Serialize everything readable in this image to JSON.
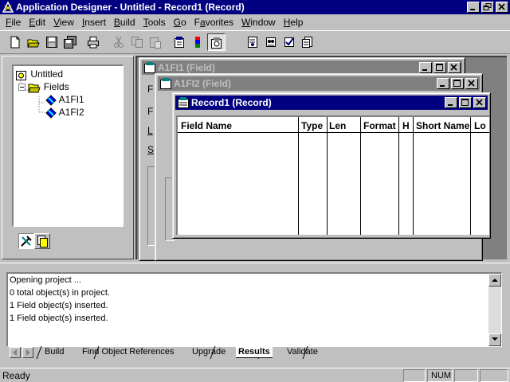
{
  "app": {
    "title": "Application Designer - Untitled - Record1 (Record)",
    "icon": "app-designer-icon"
  },
  "menu": [
    {
      "mnemonic": "F",
      "rest": "ile"
    },
    {
      "mnemonic": "E",
      "rest": "dit"
    },
    {
      "mnemonic": "V",
      "rest": "iew"
    },
    {
      "mnemonic": "I",
      "rest": "nsert"
    },
    {
      "mnemonic": "B",
      "rest": "uild"
    },
    {
      "mnemonic": "T",
      "rest": "ools"
    },
    {
      "mnemonic": "G",
      "rest": "o"
    },
    {
      "pre": "F",
      "mnemonic": "a",
      "rest": "vorites"
    },
    {
      "mnemonic": "W",
      "rest": "indow"
    },
    {
      "mnemonic": "H",
      "rest": "elp"
    }
  ],
  "toolbar": {
    "icons": [
      "new-icon",
      "open-icon",
      "save-icon",
      "save-all-icon",
      "print-icon",
      "cut-icon",
      "copy-icon",
      "paste-icon",
      "properties-icon",
      "build-icon",
      "project-workspace-icon",
      "find-references-icon",
      "record-view-icon",
      "validate-icon",
      "definition-icon"
    ]
  },
  "project_tree": {
    "root": "Untitled",
    "folder": "Fields",
    "items": [
      "A1FI1",
      "A1FI2"
    ]
  },
  "windows": {
    "field1": {
      "title": "A1FI1 (Field)"
    },
    "field2": {
      "title": "A1FI2 (Field)"
    },
    "record": {
      "title": "Record1 (Record)",
      "columns": [
        "Field Name",
        "Type",
        "Len",
        "Format",
        "H",
        "Short Name",
        "Lo"
      ]
    }
  },
  "output": {
    "lines": [
      "Opening project ...",
      "0  total object(s) in project.",
      "1 Field object(s) inserted.",
      "1 Field object(s) inserted."
    ],
    "tabs": [
      "Build",
      "Find Object References",
      "Upgrade",
      "Results",
      "Validate"
    ],
    "selected_tab": "Results"
  },
  "status": {
    "text": "Ready",
    "num": "NUM"
  },
  "colors": {
    "active_title": "#000080",
    "inactive_title": "#808080",
    "face": "#c0c0c0"
  }
}
